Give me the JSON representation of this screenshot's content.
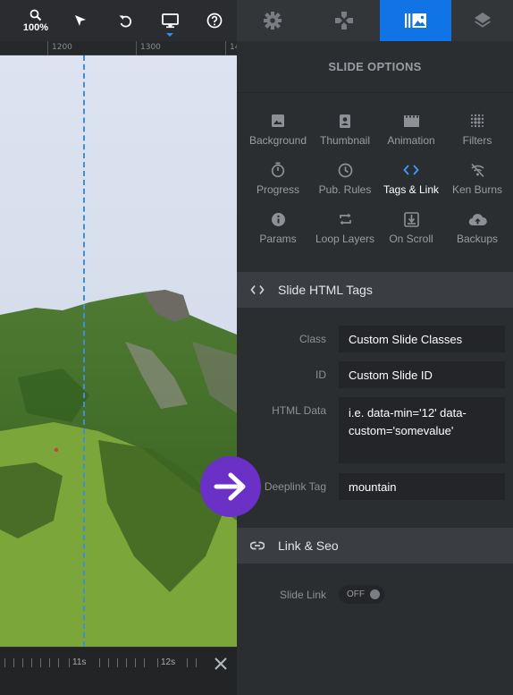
{
  "toolbar": {
    "zoom_label": "100%",
    "icons": [
      "zoom-icon",
      "pointer-icon",
      "undo-icon",
      "monitor-icon",
      "help-icon"
    ]
  },
  "ruler": {
    "labels": [
      "1200",
      "1300",
      "14"
    ]
  },
  "timeline": {
    "labels": [
      "11s",
      "12s"
    ]
  },
  "tabs": [
    "gear-icon",
    "gamepad-icon",
    "slide-options-icon",
    "layers-icon"
  ],
  "panel": {
    "title": "SLIDE OPTIONS",
    "options": [
      {
        "label": "Background",
        "icon": "image-icon"
      },
      {
        "label": "Thumbnail",
        "icon": "portrait-icon"
      },
      {
        "label": "Animation",
        "icon": "film-icon"
      },
      {
        "label": "Filters",
        "icon": "blur-icon"
      },
      {
        "label": "Progress",
        "icon": "timer-icon"
      },
      {
        "label": "Pub. Rules",
        "icon": "clock-icon"
      },
      {
        "label": "Tags & Link",
        "icon": "code-icon"
      },
      {
        "label": "Ken Burns",
        "icon": "signal-off-icon"
      },
      {
        "label": "Params",
        "icon": "info-icon"
      },
      {
        "label": "Loop Layers",
        "icon": "repeat-icon"
      },
      {
        "label": "On Scroll",
        "icon": "download-icon"
      },
      {
        "label": "Backups",
        "icon": "cloud-upload-icon"
      }
    ],
    "active_option": "Tags & Link"
  },
  "html_tags": {
    "title": "Slide HTML Tags",
    "class_label": "Class",
    "class_placeholder": "Custom Slide Classes",
    "id_label": "ID",
    "id_placeholder": "Custom Slide ID",
    "html_data_label": "HTML Data",
    "html_data_placeholder": "i.e. data-min='12' data-custom='somevalue'",
    "deeplink_label": "Deeplink Tag",
    "deeplink_value": "mountain"
  },
  "link_seo": {
    "title": "Link & Seo",
    "slide_link_label": "Slide Link",
    "slide_link_state": "OFF"
  },
  "colors": {
    "accent": "#1174e6",
    "arrow_badge": "#6b30c5",
    "panel_bg": "#2b2e31",
    "section_bg": "#3a3d41"
  }
}
